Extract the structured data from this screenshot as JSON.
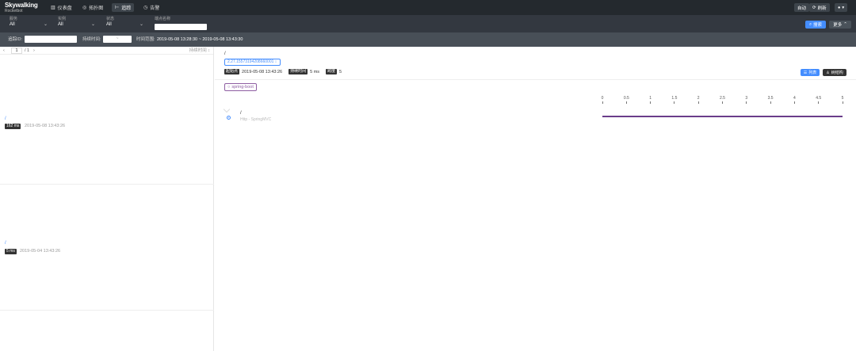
{
  "app": {
    "logo_line1": "Skywalking",
    "logo_line2": "Rocketbot"
  },
  "nav": [
    {
      "label": "仪表盘",
      "icon": "dashboard-icon",
      "glyph": "▥"
    },
    {
      "label": "拓扑图",
      "icon": "topology-icon",
      "glyph": "◎"
    },
    {
      "label": "追踪",
      "icon": "trace-icon",
      "glyph": "⊢"
    },
    {
      "label": "告警",
      "icon": "alarm-icon",
      "glyph": "◷"
    }
  ],
  "top_actions": {
    "auto": "自动",
    "refresh": "刷新",
    "user_glyph": "▾"
  },
  "filters": {
    "service": {
      "label": "服务",
      "value": "All"
    },
    "instance": {
      "label": "实例",
      "value": "All"
    },
    "status": {
      "label": "状态",
      "value": "All"
    },
    "endpoint": {
      "label": "端点名称",
      "value": ""
    }
  },
  "search_label": "搜索",
  "more_label": "更多",
  "query": {
    "trace_id_label": "追踪ID:",
    "duration_label": "持续时间:",
    "duration_sep": "~",
    "time_range_label": "时间范围:",
    "time_range_value": "2019-05-08 13:28:30 ~ 2019-05-08 13:43:30"
  },
  "pager": {
    "prev": "‹",
    "page": "1",
    "total": "/ 1",
    "next": "›",
    "sort_label": "持续时间 ↕"
  },
  "traces": [
    {
      "endpoint": "/",
      "duration": "162 ms",
      "time": "2019-05-08 13:43:26"
    },
    {
      "endpoint": "/",
      "duration": "5 ms",
      "time": "2019-05-04 13:43:26"
    }
  ],
  "detail": {
    "title": "/",
    "trace_id": "2.27.15573194208660001 ↕",
    "start_label": "起始点",
    "start_value": "2019-05-08 13:43:26",
    "duration_label": "持续时间",
    "duration_value": "5 ms",
    "span_label": "跨度",
    "span_value": "5",
    "list_btn": "列表",
    "tree_btn": "树结构",
    "service_chip": "spring-boot"
  },
  "timeline": {
    "ticks": [
      "0",
      "0.5",
      "1",
      "1.5",
      "2",
      "2.5",
      "3",
      "3.5",
      "4",
      "4.5",
      "5"
    ],
    "min": 0,
    "max": 5,
    "span": {
      "name": "/",
      "component": "Http - SpringMVC",
      "start": 0,
      "end": 5,
      "color": "#6a3d8a"
    }
  }
}
